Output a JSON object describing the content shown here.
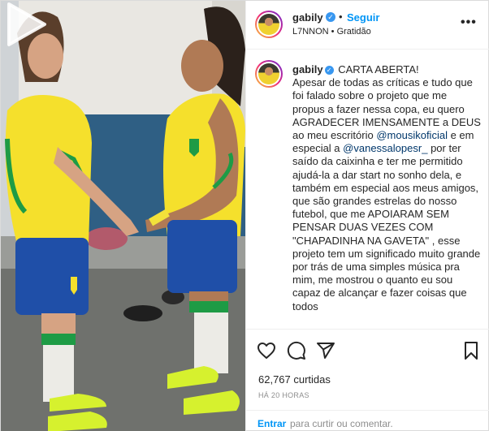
{
  "post": {
    "username": "gabily",
    "verified_badge": "✓",
    "separator": "•",
    "follow_label": "Seguir",
    "audio_label": "L7NNON • Gratidão",
    "more_label": "•••"
  },
  "caption": {
    "username": "gabily",
    "line_1": "CARTA ABERTA!",
    "text_1": "Apesar de todas as críticas e tudo que foi falado sobre o projeto que me propus a fazer nessa copa, eu quero AGRADECER IMENSAMENTE a DEUS ao meu escritório",
    "mention_1": "@mousikoficial",
    "text_2": "e em especial a",
    "mention_2": "@vanessalopesr_",
    "text_3": "por ter saído da caixinha e ter me permitido ajudá-la a dar start no sonho dela, e também em especial aos meus amigos, que são grandes estrelas do nosso futebol, que me APOIARAM SEM PENSAR DUAS VEZES COM \"CHAPADINHA NA GAVETA\" , esse projeto tem um significado muito grande por trás de uma simples música pra mim, me mostrou o quanto eu sou capaz de alcançar e fazer coisas que todos"
  },
  "stats": {
    "views": "62,767 curtidas",
    "time": "HÁ 20 HORAS"
  },
  "comment": {
    "login_label": "Entrar",
    "rest_text": "para curtir ou comentar."
  },
  "icons": {
    "like": "heart-icon",
    "comment": "comment-icon",
    "share": "share-icon",
    "save": "bookmark-icon",
    "play": "play-icon"
  },
  "colors": {
    "accent": "#0095f6",
    "mention": "#00376b",
    "jersey": "#f5e02c",
    "jersey_trim": "#1e9b45",
    "shorts": "#1f4fa8"
  }
}
